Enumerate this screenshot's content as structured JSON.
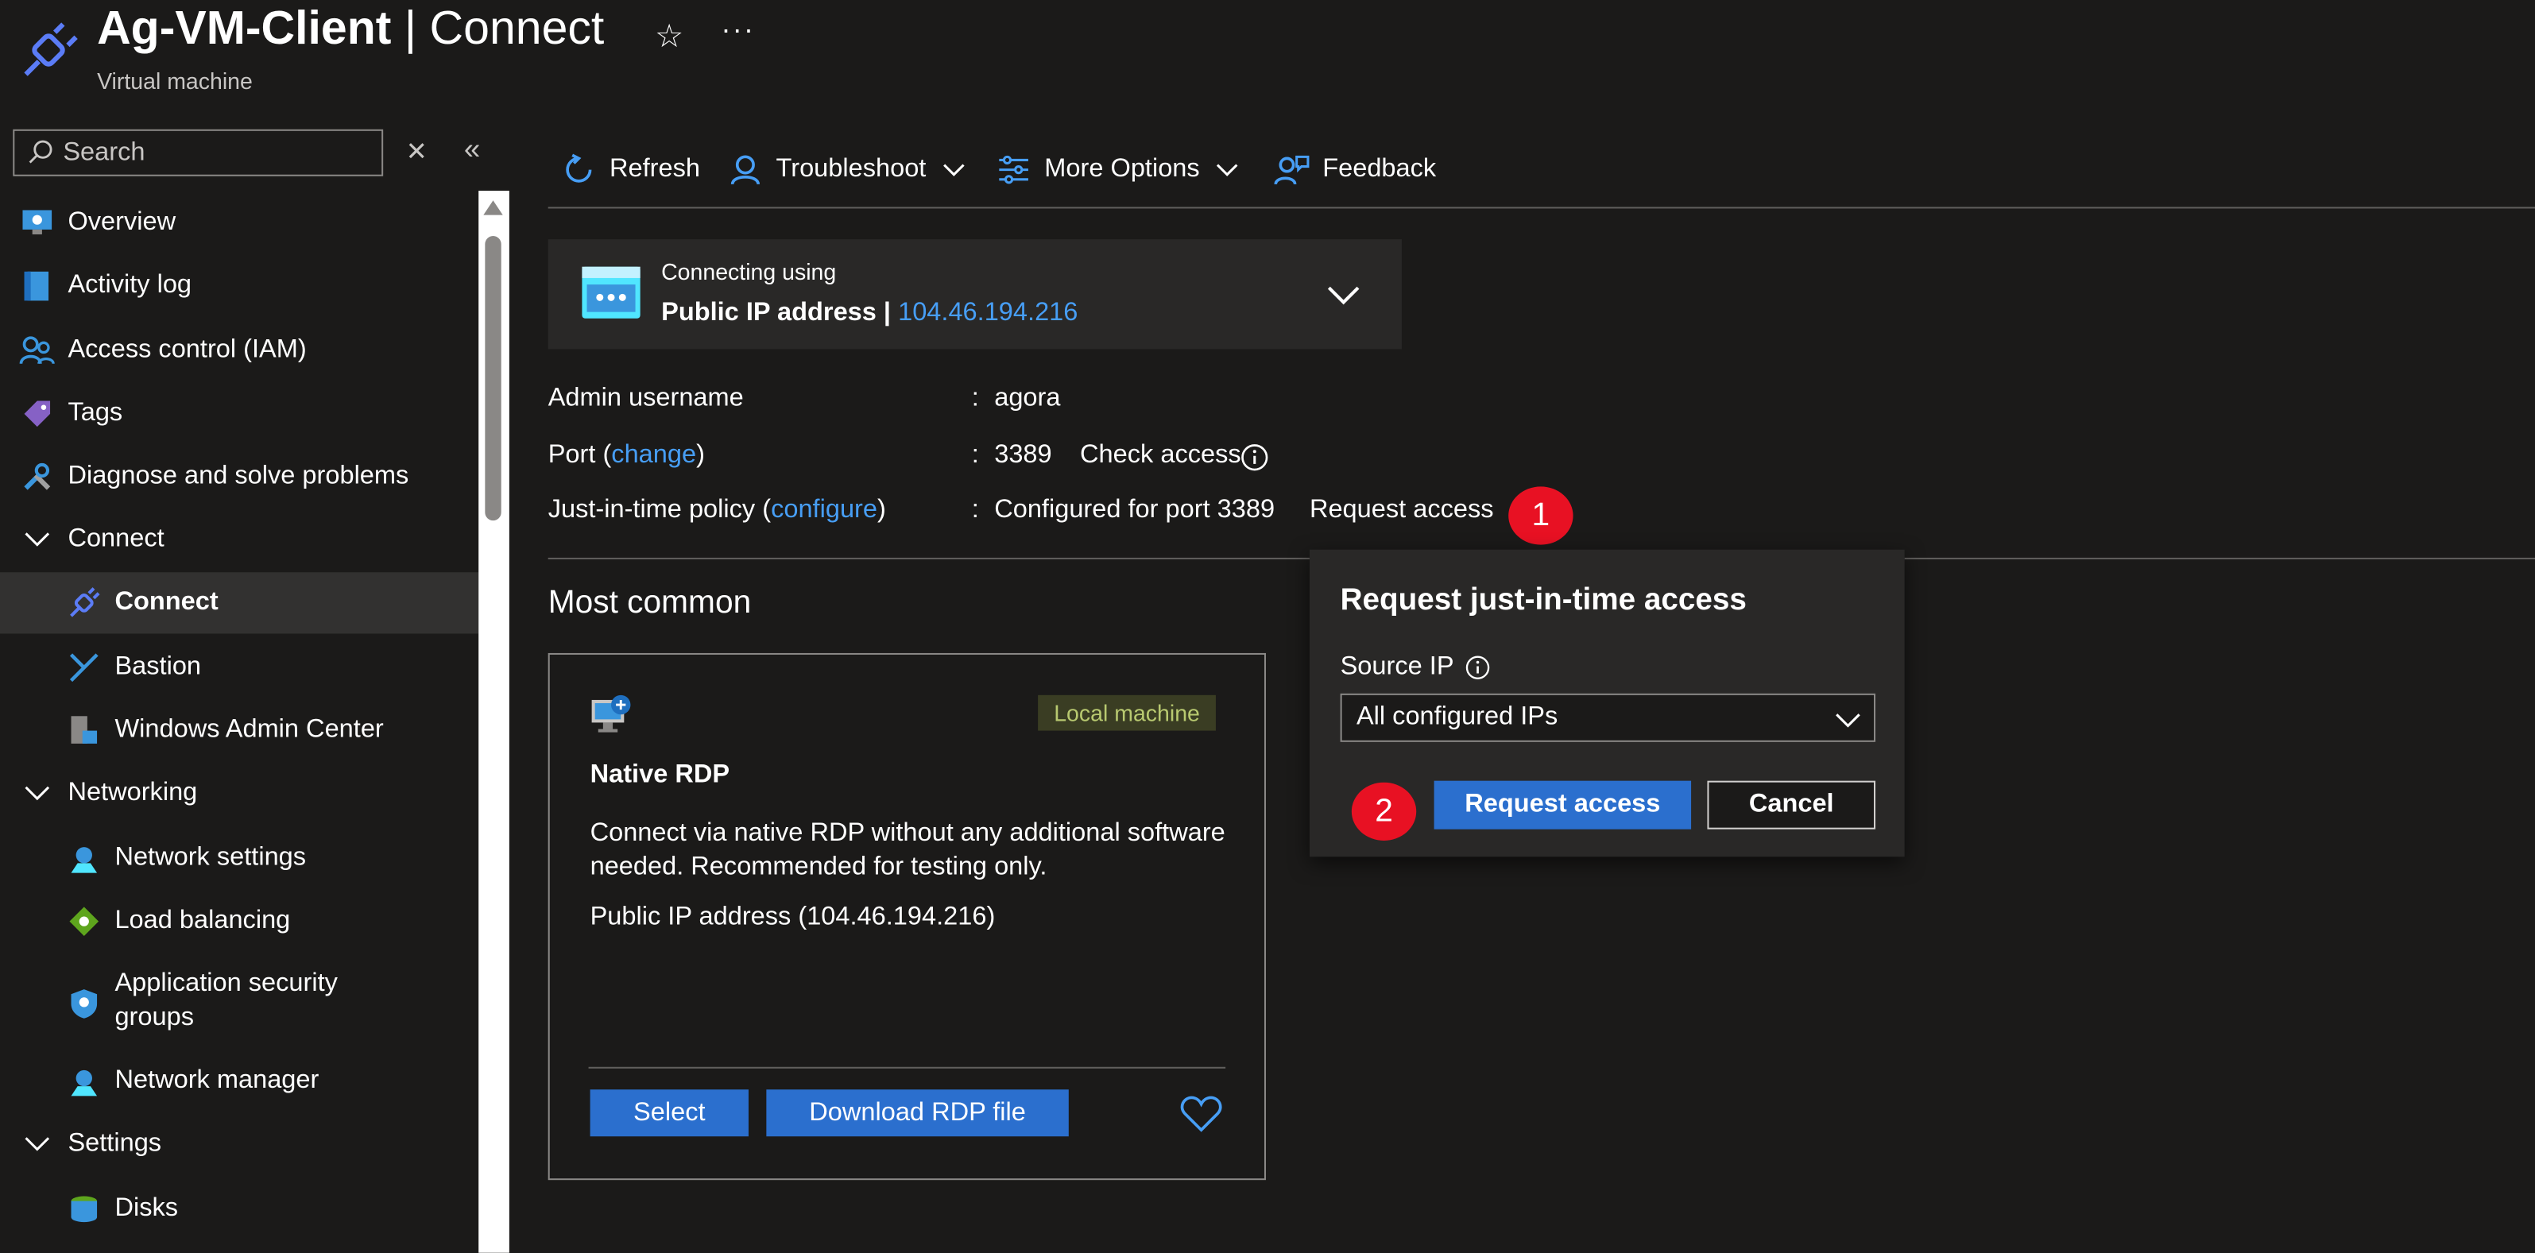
{
  "header": {
    "title_bold": "Ag-VM-Client",
    "title_rest": " | Connect",
    "subtitle": "Virtual machine"
  },
  "search": {
    "placeholder": "Search"
  },
  "sidebar": {
    "items": [
      {
        "label": "Overview",
        "icon": "monitor-icon"
      },
      {
        "label": "Activity log",
        "icon": "log-book-icon"
      },
      {
        "label": "Access control (IAM)",
        "icon": "people-icon"
      },
      {
        "label": "Tags",
        "icon": "tag-icon"
      },
      {
        "label": "Diagnose and solve problems",
        "icon": "wrench-icon"
      },
      {
        "label": "Connect",
        "icon": "chevron-down-icon",
        "group": true
      },
      {
        "label": "Connect",
        "icon": "plug-icon",
        "selected": true
      },
      {
        "label": "Bastion",
        "icon": "bastion-icon"
      },
      {
        "label": "Windows Admin Center",
        "icon": "admin-center-icon"
      },
      {
        "label": "Networking",
        "icon": "chevron-down-icon",
        "group": true
      },
      {
        "label": "Network settings",
        "icon": "network-icon"
      },
      {
        "label": "Load balancing",
        "icon": "load-balancer-icon"
      },
      {
        "label": "Application security groups",
        "icon": "shield-icon"
      },
      {
        "label": "Network manager",
        "icon": "network-manager-icon"
      },
      {
        "label": "Settings",
        "icon": "chevron-down-icon",
        "group": true
      },
      {
        "label": "Disks",
        "icon": "disks-icon"
      }
    ]
  },
  "toolbar": {
    "refresh": "Refresh",
    "troubleshoot": "Troubleshoot",
    "more_options": "More Options",
    "feedback": "Feedback"
  },
  "connecting": {
    "label": "Connecting using",
    "method": "Public IP address | ",
    "ip": "104.46.194.216"
  },
  "details": {
    "admin_label": "Admin username",
    "admin_value": "agora",
    "port_label_pre": "Port (",
    "port_link": "change",
    "port_label_post": ")",
    "port_value": "3389",
    "check_access": "Check access",
    "jit_label_pre": "Just-in-time policy (",
    "jit_link": "configure",
    "jit_label_post": ")",
    "jit_value": "Configured for port 3389",
    "request_access": "Request access",
    "colon": ":"
  },
  "annotations": {
    "badge1": "1",
    "badge2": "2"
  },
  "most_common": {
    "title": "Most common",
    "card": {
      "tag": "Local machine",
      "title": "Native RDP",
      "description": "Connect via native RDP without any additional software needed. Recommended for testing only.",
      "ip_line": "Public IP address (104.46.194.216)",
      "select": "Select",
      "download": "Download RDP file"
    }
  },
  "popup": {
    "title": "Request just-in-time access",
    "source_ip_label": "Source IP",
    "source_ip_value": "All configured IPs",
    "request_button": "Request access",
    "cancel_button": "Cancel"
  },
  "colors": {
    "background": "#1b1a19",
    "link": "#479ef5",
    "primary": "#2b6fce",
    "badge": "#e81123"
  }
}
